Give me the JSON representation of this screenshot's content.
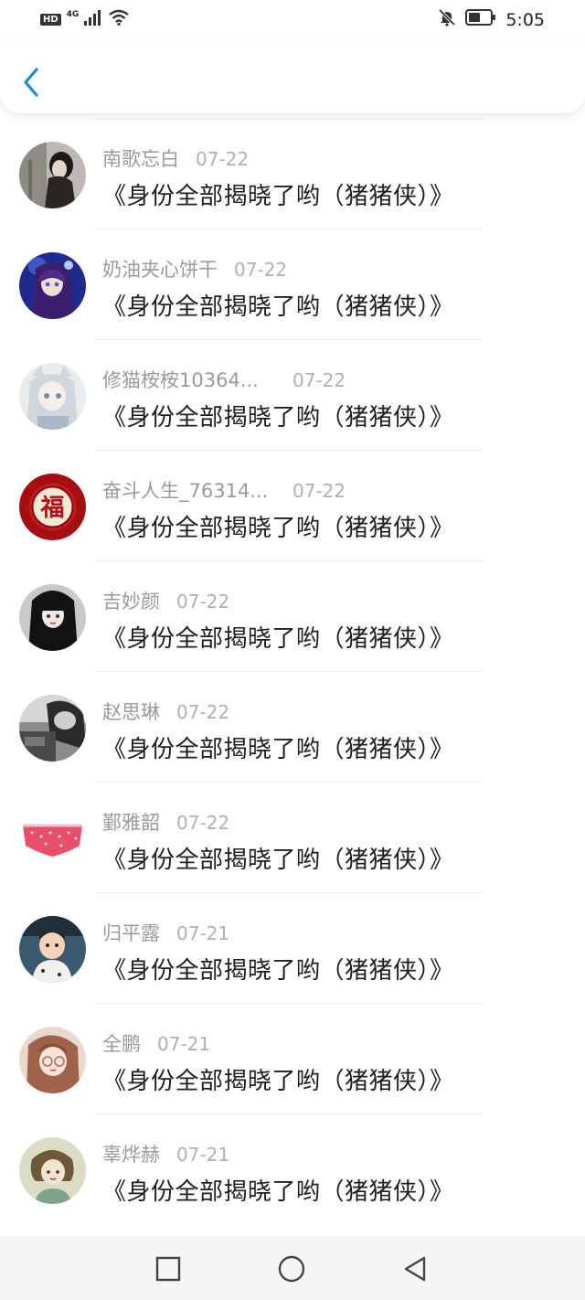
{
  "status_bar": {
    "hd": "HD",
    "network": "4G",
    "time": "5:05",
    "icons": [
      "signal-icon",
      "wifi-icon",
      "mute-bell-icon",
      "battery-icon"
    ]
  },
  "header": {
    "back_icon": "chevron-left-icon",
    "accent": "#1a8ce0"
  },
  "comments": [
    {
      "name": "南歌忘白",
      "date": "07-22",
      "text": "《身份全部揭晓了哟（猪猪侠）》"
    },
    {
      "name": "奶油夹心饼干",
      "date": "07-22",
      "text": "《身份全部揭晓了哟（猪猪侠）》"
    },
    {
      "name": "修猫桉桉10364...",
      "date": "07-22",
      "text": "《身份全部揭晓了哟（猪猪侠）》"
    },
    {
      "name": "奋斗人生_76314...",
      "date": "07-22",
      "text": "《身份全部揭晓了哟（猪猪侠）》"
    },
    {
      "name": "吉妙颜",
      "date": "07-22",
      "text": "《身份全部揭晓了哟（猪猪侠）》"
    },
    {
      "name": "赵思琳",
      "date": "07-22",
      "text": "《身份全部揭晓了哟（猪猪侠）》"
    },
    {
      "name": "鄞雅韶",
      "date": "07-22",
      "text": "《身份全部揭晓了哟（猪猪侠）》"
    },
    {
      "name": "归平露",
      "date": "07-21",
      "text": "《身份全部揭晓了哟（猪猪侠）》"
    },
    {
      "name": "全鹏",
      "date": "07-21",
      "text": "《身份全部揭晓了哟（猪猪侠）》"
    },
    {
      "name": "辜烨赫",
      "date": "07-21",
      "text": "《身份全部揭晓了哟（猪猪侠）》"
    }
  ],
  "avatar_seal_text": "福",
  "nav_bar": {
    "buttons": [
      "recents-square-icon",
      "home-circle-icon",
      "back-triangle-icon"
    ]
  }
}
